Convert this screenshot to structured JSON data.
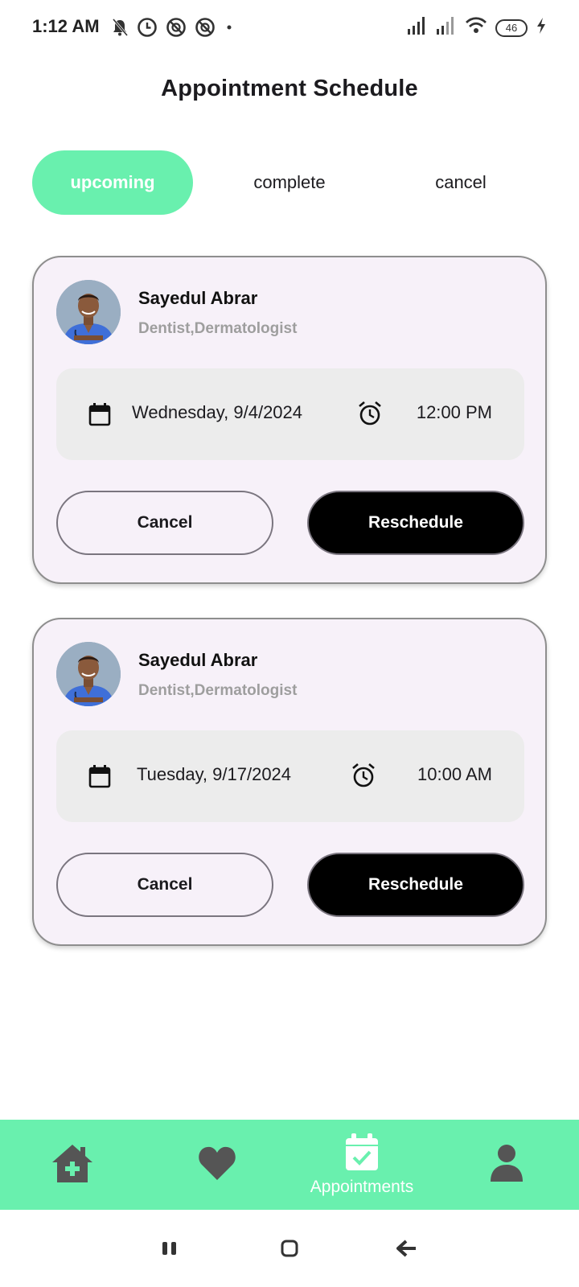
{
  "status_bar": {
    "time": "1:12 AM",
    "battery": "46",
    "icons": [
      "mute-icon",
      "alarm-icon",
      "dnd-icon",
      "dnd-icon",
      "dot-icon",
      "signal-icon",
      "signal-icon",
      "wifi-icon",
      "battery-icon",
      "charging-icon"
    ]
  },
  "header": {
    "title": "Appointment Schedule"
  },
  "tabs": [
    {
      "label": "upcoming",
      "active": true
    },
    {
      "label": "complete",
      "active": false
    },
    {
      "label": "cancel",
      "active": false
    }
  ],
  "appointments": [
    {
      "doctor_name": "Sayedul Abrar",
      "specialty": "Dentist,Dermatologist",
      "date": "Wednesday, 9/4/2024",
      "time": "12:00 PM",
      "cancel_label": "Cancel",
      "reschedule_label": "Reschedule"
    },
    {
      "doctor_name": "Sayedul Abrar",
      "specialty": "Dentist,Dermatologist",
      "date": "Tuesday, 9/17/2024",
      "time": "10:00 AM",
      "cancel_label": "Cancel",
      "reschedule_label": "Reschedule"
    }
  ],
  "bottom_nav": {
    "items": [
      {
        "icon": "home-medical-icon"
      },
      {
        "icon": "heart-icon"
      },
      {
        "icon": "calendar-check-icon",
        "label": "Appointments",
        "active": true
      },
      {
        "icon": "person-icon"
      }
    ]
  },
  "colors": {
    "accent": "#69f0ae",
    "card_bg": "#f7f1f9",
    "info_bg": "#ececec",
    "nav_icon": "#555555"
  }
}
